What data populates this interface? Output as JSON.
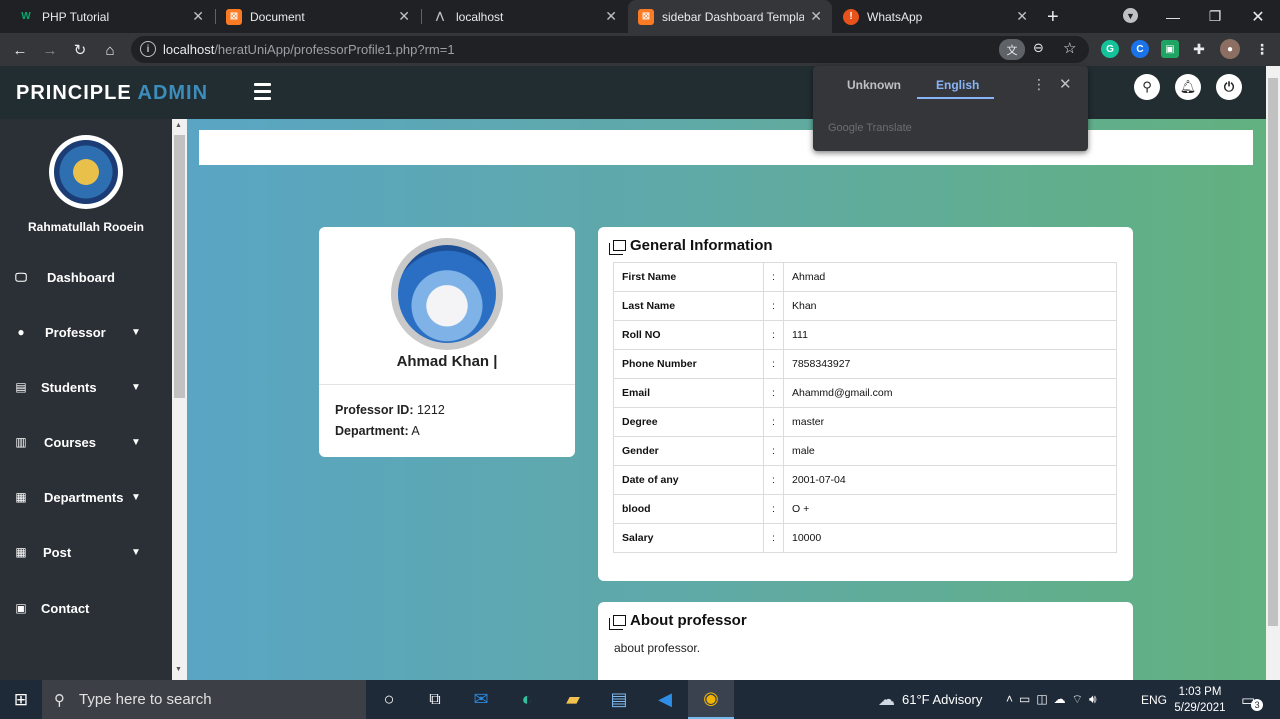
{
  "browser": {
    "tabs": [
      {
        "title": "PHP Tutorial",
        "icon": "w3schools-icon"
      },
      {
        "title": "Document",
        "icon": "xampp-icon"
      },
      {
        "title": "localhost",
        "icon": "localhost-icon"
      },
      {
        "title": "sidebar Dashboard Template",
        "icon": "xampp-icon",
        "active": true
      },
      {
        "title": "WhatsApp",
        "icon": "whatsapp-icon"
      }
    ],
    "url_host": "localhost",
    "url_path": "/heratUniApp/professorProfile1.php?rm=1"
  },
  "translate_popup": {
    "tab_unknown": "Unknown",
    "tab_english": "English",
    "brand": "Google Translate"
  },
  "app": {
    "brand_part1": "PRINCIPLE ",
    "brand_part2": "ADMIN",
    "user_name": "Rahmatullah Rooein",
    "nav": [
      {
        "label": "Dashboard",
        "icon": "monitor-icon"
      },
      {
        "label": "Professor",
        "icon": "user-circle-icon"
      },
      {
        "label": "Students",
        "icon": "id-card-icon"
      },
      {
        "label": "Courses",
        "icon": "teacher-icon"
      },
      {
        "label": "Departments",
        "icon": "building-icon"
      },
      {
        "label": "Post",
        "icon": "building-icon"
      },
      {
        "label": "Contact",
        "icon": "contact-icon"
      }
    ]
  },
  "profile": {
    "name": "Ahmad Khan |",
    "professor_id_label": "Professor ID:",
    "professor_id": "1212",
    "department_label": "Department:",
    "department": "A"
  },
  "general_info": {
    "title": "General Information",
    "rows": [
      {
        "key": "First Name",
        "value": "Ahmad"
      },
      {
        "key": "Last Name",
        "value": "Khan"
      },
      {
        "key": "Roll NO",
        "value": "111"
      },
      {
        "key": "Phone Number",
        "value": "7858343927"
      },
      {
        "key": "Email",
        "value": "Ahammd@gmail.com"
      },
      {
        "key": "Degree",
        "value": "master"
      },
      {
        "key": "Gender",
        "value": "male"
      },
      {
        "key": "Date of any",
        "value": "2001-07-04"
      },
      {
        "key": "blood",
        "value": "O +"
      },
      {
        "key": "Salary",
        "value": "10000"
      }
    ]
  },
  "about": {
    "title": "About professor",
    "text": "about professor."
  },
  "taskbar": {
    "search_placeholder": "Type here to search",
    "weather": "61°F  Advisory",
    "lang": "ENG",
    "time": "1:03 PM",
    "date": "5/29/2021",
    "notifications": "3"
  }
}
